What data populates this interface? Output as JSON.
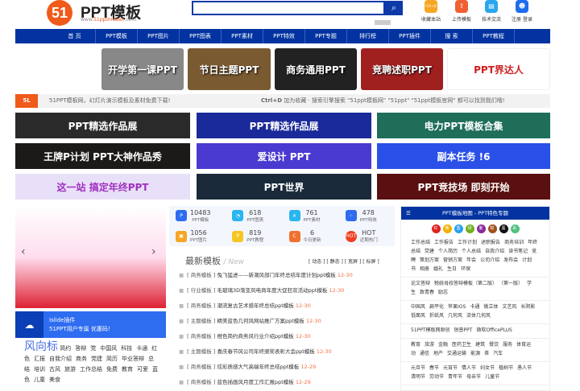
{
  "header": {
    "logo_mark": "51",
    "logo_text": "PPT模板",
    "logo_url_prefix": "www.",
    "logo_url_brand": "51pptmoban",
    "logo_url_suffix": ".com",
    "search_placeholder": "",
    "tools": [
      {
        "label": "收藏本站",
        "icon": "ctrl-d-icon",
        "glyph": "Ctrl+D",
        "color": "#f5a623"
      },
      {
        "label": "上传模板",
        "icon": "upload-icon",
        "glyph": "⇧",
        "color": "#f06030"
      },
      {
        "label": "技术交流",
        "icon": "chat-icon",
        "glyph": "▤",
        "color": "#29a6f0"
      },
      {
        "label": "注册 登录",
        "icon": "user-icon",
        "glyph": "☻",
        "color": "#1e6cf0"
      }
    ]
  },
  "nav": [
    "首 页",
    "PPT模板",
    "PPT图片",
    "PPT图表",
    "PPT素材",
    "PPT特效",
    "PPT专题",
    "排行榜",
    "PPT插件",
    "搜 索",
    "PPT教程"
  ],
  "promos": [
    {
      "label": "开学第一课PPT",
      "color": "#888"
    },
    {
      "label": "节日主题PPT",
      "color": "#7a5a30"
    },
    {
      "label": "商务通用PPT",
      "color": "#222"
    },
    {
      "label": "竞聘述职PPT",
      "color": "#a02020"
    },
    {
      "label": "PPT界达人",
      "color": "#fff"
    }
  ],
  "infobar": {
    "badge": "5L",
    "left": "51PPT模板网，幻灯片演示模板及素材免费下载!",
    "right_key": "Ctrl+D",
    "right": " 加为收藏 · 搜索引擎搜索 \"51ppt模板网\" \"51ppt\" \"51ppt模板官网\" 都可以找到我们哦!"
  },
  "banners": [
    {
      "label": "PPT精选作品展",
      "color": "#2a2a2a"
    },
    {
      "label": "PPT精选作品展",
      "color": "#1a2a9a"
    },
    {
      "label": "电力PPT模板合集",
      "color": "#1f6e5a"
    },
    {
      "label": "王牌P计划 PPT大神作品秀",
      "color": "#1c1a18"
    },
    {
      "label": "爱设计 PPT",
      "color": "#4a3ad0"
    },
    {
      "label": "副本任务 !6",
      "color": "#2b50e8"
    },
    {
      "label": "这一站 搞定年终PPT",
      "color": "#e8e0f8"
    },
    {
      "label": "PPT世界",
      "color": "#1a2a3a"
    },
    {
      "label": "PPT竞技场  即刻开始",
      "color": "#5a1010"
    }
  ],
  "slider": {
    "prev": "‹",
    "next": "›"
  },
  "islide": {
    "line1": "Islide插件",
    "line2": "51PPT用户专属 优惠码！"
  },
  "tags": {
    "title": "风向标",
    "items": [
      "简约",
      "答辩",
      "党",
      "中国风",
      "科技",
      "卡通",
      "红色",
      "汇报",
      "自我介绍",
      "商务",
      "党建",
      "简历",
      "毕业答辩",
      "总结",
      "培训",
      "古风",
      "旅游",
      "工作总结",
      "免费",
      "教育",
      "可爱",
      "蓝色",
      "儿童",
      "美食"
    ]
  },
  "stats": [
    {
      "num": "10483",
      "label": "PPT模板",
      "icon": "ppt-icon",
      "color": "#2e6cf0",
      "glyph": "P"
    },
    {
      "num": "618",
      "label": "PPT图表",
      "icon": "pie-chart-icon",
      "color": "#29b6f0",
      "glyph": "◔"
    },
    {
      "num": "761",
      "label": "PPT素材",
      "icon": "material-icon",
      "color": "#29b6f0",
      "glyph": "✕"
    },
    {
      "num": "478",
      "label": "PPT特效",
      "icon": "effect-icon",
      "color": "#2e6cf0",
      "glyph": "⁘"
    },
    {
      "num": "1056",
      "label": "PPT图片",
      "icon": "image-icon",
      "color": "#f5a623",
      "glyph": "▣"
    },
    {
      "num": "819",
      "label": "PPT教程",
      "icon": "tutorial-icon",
      "color": "#f5c623",
      "glyph": "P"
    },
    {
      "num": "6",
      "label": "今日更新",
      "icon": "refresh-icon",
      "color": "#f07030",
      "glyph": "C"
    },
    {
      "num": "HOT",
      "label": "近期热门",
      "icon": "hot-icon",
      "color": "#f04020",
      "glyph": "HOT"
    }
  ],
  "latest": {
    "title": "最新模板",
    "subtitle": "/ New",
    "filters": "[ 动态 ] [ 静态 ] [ 宽屏 ] [ 标屏 ]",
    "items": [
      {
        "cat": "商务模板",
        "title": "兔飞猛进——新潮风部门年终总结年度计划ppt模板",
        "date": "12-30"
      },
      {
        "cat": "行业模板",
        "title": "毛玻璃3D渐变风电商年度大促狂欢活动ppt模板",
        "date": "12-30"
      },
      {
        "cat": "商务模板",
        "title": "潮流复古艺术感年终总结ppt模板",
        "date": "12-30"
      },
      {
        "cat": "主题模板",
        "title": "精美蓝色几何风网站推广方案ppt模板",
        "date": "12-30"
      },
      {
        "cat": "商务模板",
        "title": "橙色简约商务风行业介绍ppt模板",
        "date": "12-30"
      },
      {
        "cat": "主题模板",
        "title": "喜庆春节风公司年终颁奖表彰大会ppt模板",
        "date": "12-30"
      },
      {
        "cat": "商务模板",
        "title": "炫彩质感大气高端年终总结ppt模板",
        "date": "12-29"
      },
      {
        "cat": "商务模板",
        "title": "蓝色插画风月度工作汇报ppt模板",
        "date": "12-29"
      }
    ]
  },
  "map": {
    "title": "PPT模板地图 - PPT特色专题",
    "colors": [
      {
        "label": "红",
        "color": "#e02020"
      },
      {
        "label": "黄",
        "color": "#f0b000"
      },
      {
        "label": "蓝",
        "color": "#29a0f0"
      },
      {
        "label": "绿",
        "color": "#70b020"
      },
      {
        "label": "紫",
        "color": "#8a2a9a"
      },
      {
        "label": "棕",
        "color": "#a0501a"
      },
      {
        "label": "黑",
        "color": "#111111"
      },
      {
        "label": "彩",
        "color": "#50c080"
      }
    ],
    "sections": [
      [
        "工作总结",
        "工作报告",
        "工作计划",
        "述职报告",
        "商务培训",
        "年终总结",
        "党建",
        "个人简历",
        "个人总结",
        "自我介绍",
        "读书笔记",
        "竞聘",
        "策划方案",
        "营销方案",
        "年会",
        "公司介绍",
        "发布会",
        "计划书",
        "相册",
        "婚礼",
        "生日",
        "环保"
      ],
      [
        "论文答辩",
        "税统母校答辩模板（第二版）",
        "（第一版）",
        "学生",
        "致青春",
        "励志"
      ],
      [
        "中国风",
        "扁平化",
        "苹果IOS",
        "卡通",
        "微立体",
        "文艺风",
        "长阴影",
        "低面风",
        "折纸风",
        "几何风",
        "流体几何风"
      ],
      [
        "51PPT模板网原创",
        "锐普PPT",
        "微软OfficePLUS"
      ],
      [
        "教育",
        "旅游",
        "金融",
        "医药卫生",
        "建筑",
        "餐饮",
        "服务",
        "体育运动",
        "通信",
        "地产",
        "交通运输",
        "能源",
        "茶",
        "汽车"
      ],
      [
        "元旦节",
        "春节",
        "元宵节",
        "情人节",
        "妇女节",
        "植树节",
        "愚人节",
        "清明节",
        "劳动节",
        "青年节",
        "母亲节",
        "儿童节"
      ]
    ]
  }
}
